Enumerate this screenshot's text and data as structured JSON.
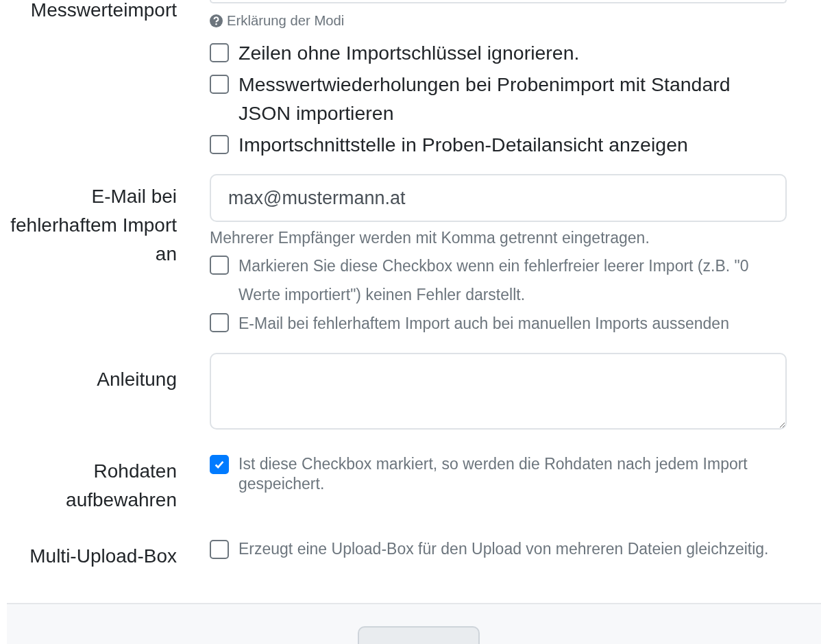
{
  "rows": [
    {
      "label": "Messwerteimport",
      "help_link": "Erklärung der Modi",
      "options": [
        {
          "label": "Zeilen ohne Importschlüssel ignorieren.",
          "checked": false
        },
        {
          "label": "Messwertwiederholungen bei Probenimport mit Standard JSON importieren",
          "checked": false
        },
        {
          "label": "Importschnittstelle in Proben-Detailansicht anzeigen",
          "checked": false
        }
      ]
    },
    {
      "label": "E-Mail bei fehlerhaftem Import an",
      "field": {
        "kind": "input",
        "value": "max@mustermann.at"
      },
      "hint": "Mehrerer Empfänger werden mit Komma getrennt eingetragen.",
      "options": [
        {
          "label": "Markieren Sie diese Checkbox wenn ein fehlerfreier leerer Import (z.B. \"0 Werte importiert\") keinen Fehler darstellt.",
          "checked": false
        },
        {
          "label": "E-Mail bei fehlerhaftem Import auch bei manuellen Imports aussenden",
          "checked": false
        }
      ]
    },
    {
      "label": "Anleitung",
      "field": {
        "kind": "textarea"
      }
    },
    {
      "label": "Rohdaten aufbewahren",
      "options": [
        {
          "label": "Ist diese Checkbox markiert, so werden die Rohdaten nach jedem Import gespeichert.",
          "checked": true
        }
      ]
    },
    {
      "label": "Multi-Upload-Box",
      "options": [
        {
          "label": "Erzeugt eine Upload-Box für den Upload von mehreren Dateien gleichzeitig.",
          "checked": false
        }
      ]
    }
  ]
}
